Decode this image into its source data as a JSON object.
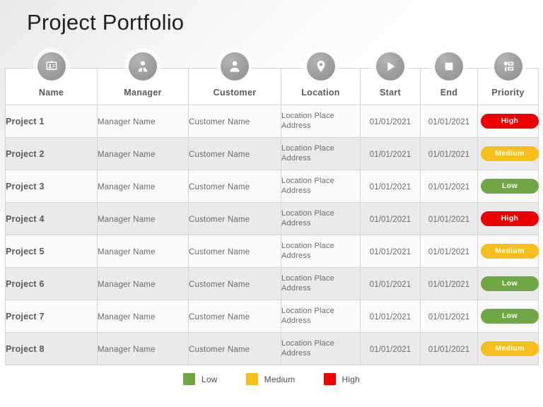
{
  "header": {
    "title": "Project Portfolio"
  },
  "table": {
    "columns": [
      {
        "key": "name",
        "label": "Name",
        "icon": "id-badge-icon"
      },
      {
        "key": "manager",
        "label": "Manager",
        "icon": "person-tie-icon"
      },
      {
        "key": "customer",
        "label": "Customer",
        "icon": "person-icon"
      },
      {
        "key": "location",
        "label": "Location",
        "icon": "map-pin-icon"
      },
      {
        "key": "start",
        "label": "Start",
        "icon": "play-icon"
      },
      {
        "key": "end",
        "label": "End",
        "icon": "stop-square-icon"
      },
      {
        "key": "priority",
        "label": "Priority",
        "icon": "priority-list-icon"
      }
    ],
    "rows": [
      {
        "name": "Project 1",
        "manager": "Manager Name",
        "customer": "Customer  Name",
        "location_line1": "Location Place",
        "location_line2": "Address",
        "start": "01/01/2021",
        "end": "01/01/2021",
        "priority": "High",
        "priority_color": "#ec0000"
      },
      {
        "name": "Project 2",
        "manager": "Manager Name",
        "customer": "Customer  Name",
        "location_line1": "Location Place",
        "location_line2": "Address",
        "start": "01/01/2021",
        "end": "01/01/2021",
        "priority": "Medium",
        "priority_color": "#f6bf1b"
      },
      {
        "name": "Project 3",
        "manager": "Manager Name",
        "customer": "Customer  Name",
        "location_line1": "Location Place",
        "location_line2": "Address",
        "start": "01/01/2021",
        "end": "01/01/2021",
        "priority": "Low",
        "priority_color": "#6fa744"
      },
      {
        "name": "Project 4",
        "manager": "Manager Name",
        "customer": "Customer  Name",
        "location_line1": "Location Place",
        "location_line2": "Address",
        "start": "01/01/2021",
        "end": "01/01/2021",
        "priority": "High",
        "priority_color": "#ec0000"
      },
      {
        "name": "Project 5",
        "manager": "Manager Name",
        "customer": "Customer  Name",
        "location_line1": "Location Place",
        "location_line2": "Address",
        "start": "01/01/2021",
        "end": "01/01/2021",
        "priority": "Medium",
        "priority_color": "#f6bf1b"
      },
      {
        "name": "Project 6",
        "manager": "Manager Name",
        "customer": "Customer  Name",
        "location_line1": "Location Place",
        "location_line2": "Address",
        "start": "01/01/2021",
        "end": "01/01/2021",
        "priority": "Low",
        "priority_color": "#6fa744"
      },
      {
        "name": "Project 7",
        "manager": "Manager Name",
        "customer": "Customer  Name",
        "location_line1": "Location Place",
        "location_line2": "Address",
        "start": "01/01/2021",
        "end": "01/01/2021",
        "priority": "Low",
        "priority_color": "#6fa744"
      },
      {
        "name": "Project 8",
        "manager": "Manager Name",
        "customer": "Customer  Name",
        "location_line1": "Location Place",
        "location_line2": "Address",
        "start": "01/01/2021",
        "end": "01/01/2021",
        "priority": "Medium",
        "priority_color": "#f6bf1b"
      }
    ]
  },
  "legend": {
    "items": [
      {
        "label": "Low",
        "color": "#6fa744"
      },
      {
        "label": "Medium",
        "color": "#f6bf1b"
      },
      {
        "label": "High",
        "color": "#ec0000"
      }
    ]
  }
}
